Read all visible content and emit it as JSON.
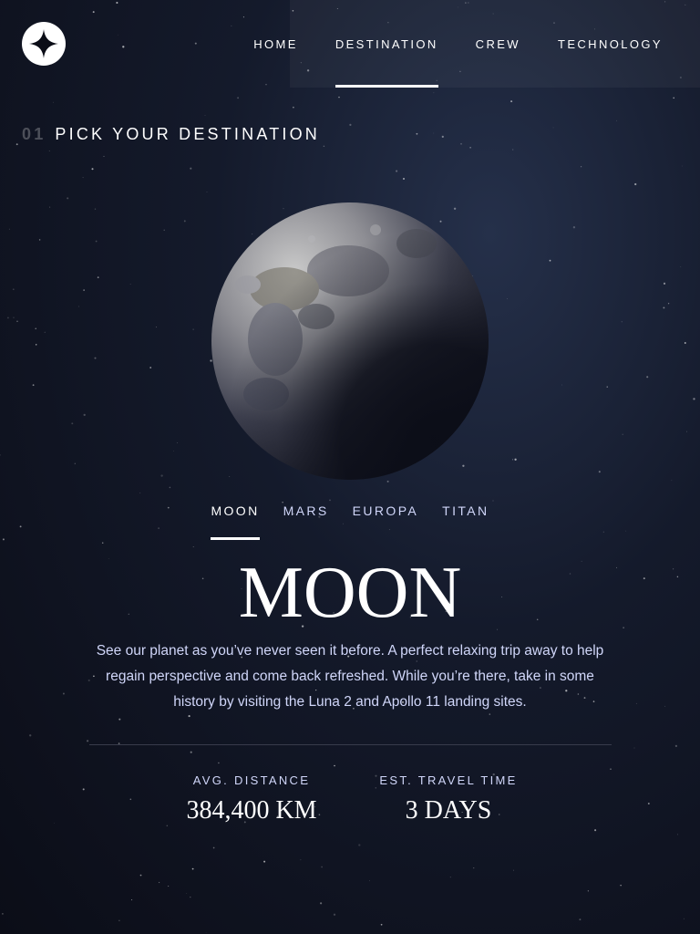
{
  "colors": {
    "background": "#0b0d17",
    "accent": "#d0d6f9",
    "text": "#ffffff"
  },
  "logo": {
    "icon": "four-point-star-icon"
  },
  "nav": {
    "items": [
      {
        "label": "HOME",
        "active": false
      },
      {
        "label": "DESTINATION",
        "active": true
      },
      {
        "label": "CREW",
        "active": false
      },
      {
        "label": "TECHNOLOGY",
        "active": false
      }
    ]
  },
  "page": {
    "number": "01",
    "heading": "PICK YOUR DESTINATION"
  },
  "planet": {
    "name": "moon"
  },
  "tabs": [
    {
      "label": "MOON",
      "active": true
    },
    {
      "label": "MARS",
      "active": false
    },
    {
      "label": "EUROPA",
      "active": false
    },
    {
      "label": "TITAN",
      "active": false
    }
  ],
  "destination": {
    "title": "MOON",
    "description": "See our planet as you’ve never seen it before. A perfect relaxing trip away to help regain perspective and come back refreshed. While you’re there, take in some history by visiting the Luna 2 and Apollo 11 landing sites.",
    "stats": [
      {
        "label": "AVG. DISTANCE",
        "value": "384,400 KM"
      },
      {
        "label": "EST. TRAVEL TIME",
        "value": "3 DAYS"
      }
    ]
  }
}
